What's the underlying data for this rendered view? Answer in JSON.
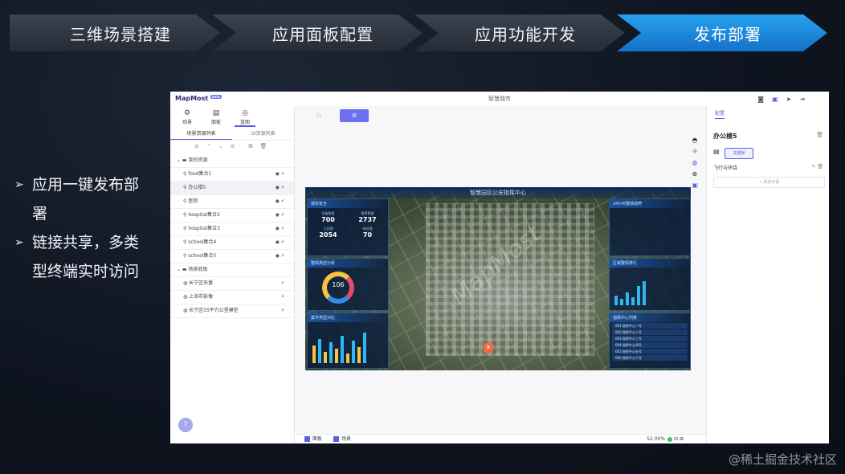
{
  "steps": [
    {
      "label": "三维场景搭建"
    },
    {
      "label": "应用面板配置"
    },
    {
      "label": "应用功能开发"
    },
    {
      "label": "发布部署"
    }
  ],
  "bullets": [
    "应用一键发布部署",
    "链接共享，多类型终端实时访问"
  ],
  "app": {
    "title": "智慧城市",
    "logo": "MapMost",
    "logo_badge": "beta",
    "mode_tabs": [
      "场景",
      "面板",
      "蓝图"
    ],
    "resource_tabs": [
      "场景资源列表",
      "UI资源列表"
    ],
    "tree": {
      "groups": [
        {
          "label": "我的资源",
          "items": [
            "food集合1",
            "办公楼5",
            "医院",
            "hospital集合2",
            "hospital集合3",
            "school集合4",
            "school集合5"
          ]
        },
        {
          "label": "场景底板",
          "items": [
            "长宁区矢量",
            "上海市影像",
            "长宁区55平方公里模型"
          ]
        }
      ]
    },
    "help": "?",
    "scene": {
      "title": "智慧园区公安指挥中心",
      "watermark": "MapMost",
      "panels": {
        "city_safety": {
          "title": "城市安全",
          "stats": [
            {
              "label": "设备数量",
              "value": "700"
            },
            {
              "label": "报警数量",
              "value": "2737"
            },
            {
              "label": "已处理",
              "value": "2054"
            },
            {
              "label": "待处理",
              "value": "70"
            }
          ]
        },
        "alarm_types": {
          "title": "警情类型分析",
          "value": "106"
        },
        "case_types": {
          "title": "案件类型对比"
        },
        "trend": {
          "title": "24小时警情趋势"
        },
        "district_rank": {
          "title": "区域警情排行"
        },
        "list": {
          "title": "指挥中心列表",
          "rows": [
            "001 指挥中心一号",
            "002 指挥中心二号",
            "003 指挥中心三号",
            "004 指挥中心四号",
            "005 指挥中心五号",
            "006 指挥中心六号"
          ]
        }
      },
      "bars": [
        22,
        30,
        14,
        26,
        18,
        34,
        12,
        28,
        20,
        38
      ],
      "rank_bars": [
        12,
        8,
        16,
        10,
        24,
        30
      ]
    },
    "bottom": {
      "panel_label": "面板",
      "scene_label": "场景",
      "zoom": "52.00%"
    },
    "right": {
      "tab": "配置",
      "name": "办公楼5",
      "button": "关键帧",
      "section": "飞行与环绕",
      "add": "+ 新增步骤"
    }
  },
  "footer_watermark": "@稀土掘金技术社区",
  "colors": {
    "active_step": "#1e8de0",
    "accent": "#5b5fe0"
  }
}
